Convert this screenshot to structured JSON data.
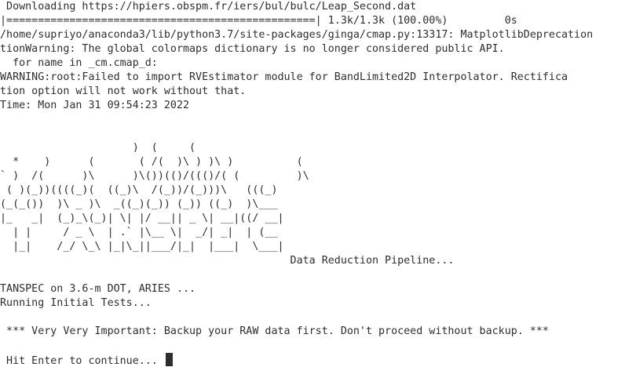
{
  "terminal": {
    "lines": [
      " Downloading https://hpiers.obspm.fr/iers/bul/bulc/Leap_Second.dat",
      "|=================================================| 1.3k/1.3k (100.00%)         0s",
      "/home/supriyo/anaconda3/lib/python3.7/site-packages/ginga/cmap.py:13317: MatplotlibDeprecationWarning: The global colormaps dictionary is no longer considered public API.",
      "tionWarning: The global colormaps dictionary is no longer considered public API.",
      "  for name in _cm.cmap_d:",
      "WARNING:root:Failed to import RVEstimator module for BandLimited2D Interpolator. Rectifica",
      "tion option will not work without that.",
      "Time: Mon Jan 31 09:54:23 2022",
      "",
      "",
      "                     )  (     (",
      "  *    )      (       ( /(  )\\ ) )\\ )          (",
      "` )  /(      )\\      )\\())(()/((()/( (         )\\",
      " ( )(_))((((_)(  ((_)\\  /(_))/(_)))\\   (((_)",
      "(_(_())  )\\ _ )\\  _((_)(_)) (_)) ((_)  )\\___",
      "|_   _|  (_)_\\(_)| \\| |/ __|| _ \\| __|((/ __|",
      "  | |     / _ \\  | .` |\\__ \\|  _/| _|  | (__",
      "  |_|    /_/ \\_\\ |_|\\_||___/|_|  |___|  \\___|",
      "                                              Data Reduction Pipeline...",
      "",
      "TANSPEC on 3.6-m DOT, ARIES ...",
      "Running Initial Tests...",
      "",
      " *** Very Very Important: Backup your RAW data first. Don't proceed without backup. ***",
      "",
      " Hit Enter to continue... "
    ]
  }
}
